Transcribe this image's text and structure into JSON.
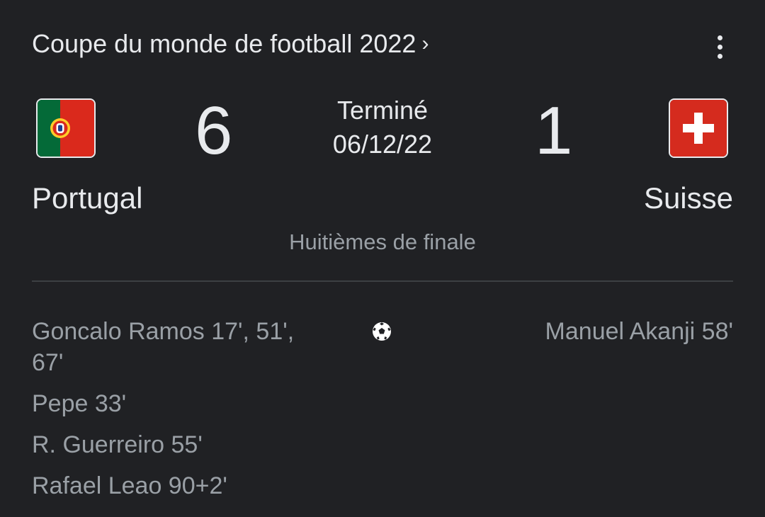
{
  "header": {
    "title": "Coupe du monde de football 2022",
    "chevron": "›",
    "menu_icon": "more-vert-icon"
  },
  "match": {
    "status": "Terminé",
    "date": "06/12/22",
    "stage": "Huitièmes de finale",
    "home": {
      "name": "Portugal",
      "score": "6",
      "flag": "portugal-flag-icon"
    },
    "away": {
      "name": "Suisse",
      "score": "1",
      "flag": "switzerland-flag-icon"
    }
  },
  "scorers": {
    "icon": "soccer-ball-icon",
    "home": [
      "Goncalo Ramos 17', 51', 67'",
      "Pepe 33'",
      "R. Guerreiro 55'",
      "Rafael Leao 90+2'"
    ],
    "away": [
      "Manuel Akanji 58'"
    ]
  },
  "colors": {
    "background": "#202124",
    "text_primary": "#e8eaed",
    "text_secondary": "#9aa0a6",
    "divider": "#3c4043",
    "portugal_green": "#046a38",
    "portugal_red": "#da291c",
    "swiss_red": "#d52b1e"
  }
}
